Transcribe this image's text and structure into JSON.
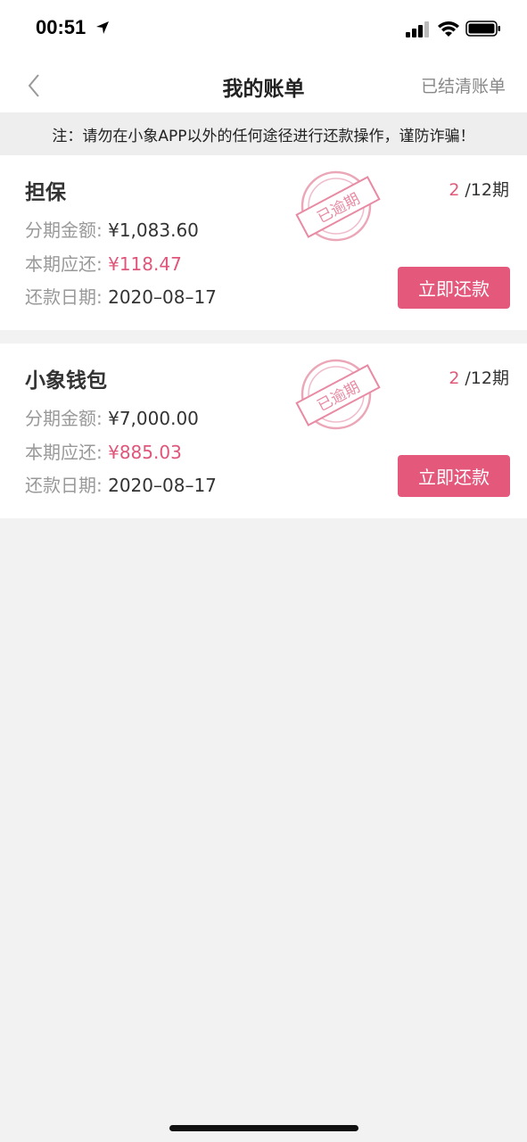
{
  "status_bar": {
    "time": "00:51"
  },
  "nav": {
    "title": "我的账单",
    "settled_label": "已结清账单"
  },
  "notice": "注：请勿在小象APP以外的任何途径进行还款操作，谨防诈骗！",
  "labels": {
    "installment_amount": "分期金额:",
    "current_due": "本期应还:",
    "due_date": "还款日期:"
  },
  "stamp_text": "已逾期",
  "bills": [
    {
      "name": "担保",
      "period_current": "2",
      "period_total": "/12期",
      "installment_amount": "¥1,083.60",
      "current_due": "¥118.47",
      "due_date": "2020–08–17",
      "pay_label": "立即还款"
    },
    {
      "name": "小象钱包",
      "period_current": "2",
      "period_total": "/12期",
      "installment_amount": "¥7,000.00",
      "current_due": "¥885.03",
      "due_date": "2020–08–17",
      "pay_label": "立即还款"
    }
  ],
  "colors": {
    "accent": "#e3587b",
    "stamp": "#e88aa3"
  }
}
